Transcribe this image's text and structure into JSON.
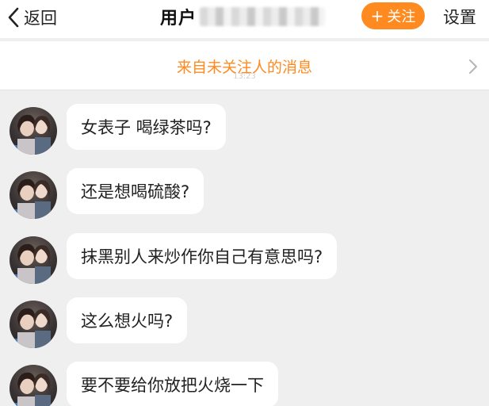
{
  "header": {
    "back_label": "返回",
    "title": "用户",
    "follow_label": "关注",
    "follow_plus": "+",
    "settings_label": "设置"
  },
  "banner": {
    "text": "来自未关注人的消息",
    "time": "13:23"
  },
  "messages": [
    {
      "text": "女表子 喝绿茶吗?"
    },
    {
      "text": "还是想喝硫酸?"
    },
    {
      "text": "抹黑别人来炒作你自己有意思吗?"
    },
    {
      "text": "这么想火吗?"
    },
    {
      "text": "要不要给你放把火烧一下"
    }
  ],
  "colors": {
    "accent": "#ff8a1f",
    "background": "#efefef",
    "bubble": "#ffffff"
  }
}
